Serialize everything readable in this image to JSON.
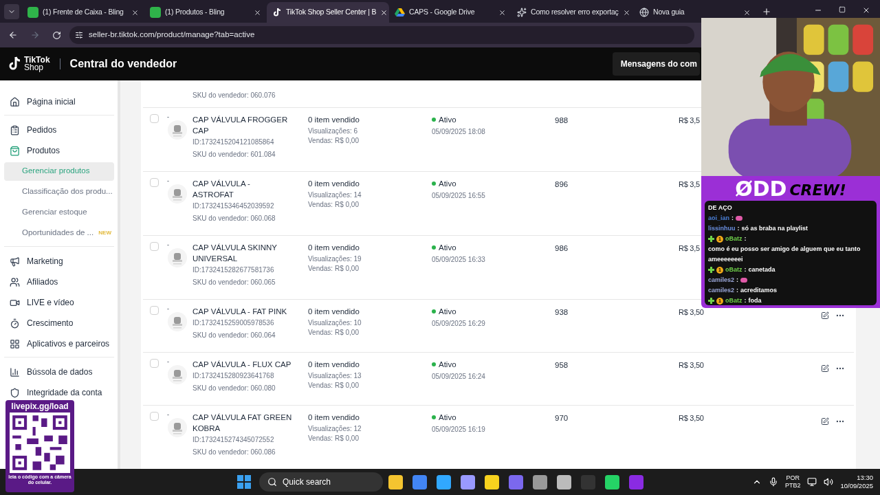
{
  "browser": {
    "tabs": [
      {
        "title": "(1) Frente de Caixa - Bling",
        "selected": false
      },
      {
        "title": "(1) Produtos - Bling",
        "selected": false
      },
      {
        "title": "TikTok Shop Seller Center | B",
        "selected": true
      },
      {
        "title": "CAPS - Google Drive",
        "selected": false
      },
      {
        "title": "Como resolver erro exportaç",
        "selected": false
      },
      {
        "title": "Nova guia",
        "selected": false
      }
    ],
    "url": "seller-br.tiktok.com/product/manage?tab=active"
  },
  "header": {
    "logo_top": "TikTok",
    "logo_bottom": "Shop",
    "title": "Central do vendedor",
    "messages_button": "Mensagens do com"
  },
  "sidebar": {
    "groups": [
      [
        {
          "label": "Página inicial",
          "selected": false
        }
      ],
      [
        {
          "label": "Pedidos",
          "selected": false
        },
        {
          "label": "Produtos",
          "selected": false,
          "expanded": true,
          "children": [
            {
              "label": "Gerenciar produtos",
              "selected": true
            },
            {
              "label": "Classificação dos produ...",
              "selected": false
            },
            {
              "label": "Gerenciar estoque",
              "selected": false
            },
            {
              "label": "Oportunidades de ...",
              "badge": "NEW",
              "selected": false
            }
          ]
        }
      ],
      [
        {
          "label": "Marketing",
          "selected": false
        },
        {
          "label": "Afiliados",
          "selected": false
        },
        {
          "label": "LIVE e vídeo",
          "selected": false
        },
        {
          "label": "Crescimento",
          "selected": false
        },
        {
          "label": "Aplicativos e parceiros",
          "selected": false
        }
      ],
      [
        {
          "label": "Bússola de dados",
          "selected": false
        },
        {
          "label": "Integridade da conta",
          "selected": false
        }
      ]
    ]
  },
  "products": {
    "top_partial_sku": "SKU do vendedor: 060.076",
    "rows": [
      {
        "checked": false,
        "mark": "-",
        "name": "CAP VÁLVULA FROGGER CAP",
        "id": "ID:1732415204121085864",
        "sku": "SKU do vendedor: 601.084",
        "sold": "0 item vendido",
        "views": "Visualizações: 6",
        "sales": "Vendas: R$ 0,00",
        "status": "Ativo",
        "active": true,
        "date": "05/09/2025 18:08",
        "stock": "988",
        "price": "R$ 3,5",
        "actions": false
      },
      {
        "checked": false,
        "mark": "-",
        "name": "CAP VÁLVULA - ASTROFAT",
        "id": "ID:1732415346452039592",
        "sku": "SKU do vendedor: 060.068",
        "sold": "0 item vendido",
        "views": "Visualizações: 14",
        "sales": "Vendas: R$ 0,00",
        "status": "Ativo",
        "active": true,
        "date": "05/09/2025 16:55",
        "stock": "896",
        "price": "R$ 3,5",
        "actions": false
      },
      {
        "checked": false,
        "mark": "-",
        "name": "CAP VÁLVULA SKINNY UNIVERSAL",
        "id": "ID:1732415282677581736",
        "sku": "SKU do vendedor: 060.065",
        "sold": "0 item vendido",
        "views": "Visualizações: 19",
        "sales": "Vendas: R$ 0,00",
        "status": "Ativo",
        "active": true,
        "date": "05/09/2025 16:33",
        "stock": "986",
        "price": "R$ 3,5",
        "actions": false
      },
      {
        "checked": false,
        "mark": "-",
        "name": "CAP VÁLVULA - FAT PINK",
        "id": "ID:1732415259005978536",
        "sku": "SKU do vendedor: 060.064",
        "sold": "0 item vendido",
        "views": "Visualizações: 10",
        "sales": "Vendas: R$ 0,00",
        "status": "Ativo",
        "active": true,
        "date": "05/09/2025 16:29",
        "stock": "938",
        "price": "R$ 3,50",
        "actions": true
      },
      {
        "checked": false,
        "mark": "-",
        "name": "CAP VÁLVULA - FLUX CAP",
        "id": "ID:1732415280923641768",
        "sku": "SKU do vendedor: 060.080",
        "sold": "0 item vendido",
        "views": "Visualizações: 13",
        "sales": "Vendas: R$ 0,00",
        "status": "Ativo",
        "active": true,
        "date": "05/09/2025 16:24",
        "stock": "958",
        "price": "R$ 3,50",
        "actions": true
      },
      {
        "checked": false,
        "mark": "-",
        "name": "CAP VÁLVULA FAT GREEN KOBRA",
        "id": "ID:1732415274345072552",
        "sku": "SKU do vendedor: 060.086",
        "sold": "0 item vendido",
        "views": "Visualizações: 12",
        "sales": "Vendas: R$ 0,00",
        "status": "Ativo",
        "active": true,
        "date": "05/09/2025 16:19",
        "stock": "970",
        "price": "R$ 3,50",
        "actions": true
      }
    ]
  },
  "overlay": {
    "logo_left": "ØDD",
    "logo_right": "CREW!",
    "chat_header": "DE AÇO",
    "messages": [
      {
        "user": "aoi_ian",
        "color": "#4a7fd6",
        "sep": ":",
        "kind": "emote"
      },
      {
        "user": "lissinhuu",
        "color": "#6a8fe0",
        "sep": ":",
        "kind": "text",
        "text": "só as braba na playlist"
      },
      {
        "user": "oBatz",
        "color": "#6fd14a",
        "sep": ":",
        "kind": "text",
        "badge": "1",
        "text": "como é eu posso ser amigo de alguem que eu tanto ameeeeeeei"
      },
      {
        "user": "oBatz",
        "color": "#6fd14a",
        "sep": ":",
        "kind": "text",
        "badge": "1",
        "text": "canetada"
      },
      {
        "user": "camiles2",
        "color": "#9aa6d8",
        "sep": ":",
        "kind": "emote"
      },
      {
        "user": "camiles2",
        "color": "#9aa6d8",
        "sep": ":",
        "kind": "text",
        "text": "acreditamos"
      },
      {
        "user": "oBatz",
        "color": "#6fd14a",
        "sep": ":",
        "kind": "text",
        "badge": "1",
        "text": "foda"
      }
    ],
    "qr_title": "livepix.gg/load",
    "qr_caption": "leia o código com a câmera do celular."
  },
  "taskbar": {
    "search": "Quick search",
    "language": "POR",
    "layout": "PTB2",
    "time": "13:30",
    "date": "10/09/2025"
  }
}
